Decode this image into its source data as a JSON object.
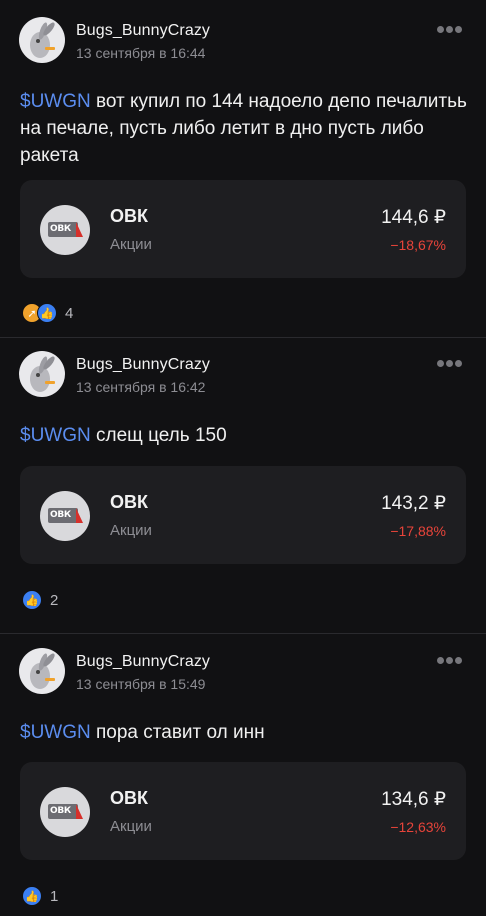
{
  "posts": [
    {
      "author": "Bugs_BunnyCrazy",
      "timestamp": "13 сентября в 16:44",
      "ticker": "$UWGN",
      "text": " вот купил по 144 надоело депо печалитьь на печале, пусть либо летит в дно пусть либо ракета",
      "card": {
        "name": "ОВК",
        "subtitle": "Акции",
        "price": "144,6 ₽",
        "change": "−18,67%",
        "logo_text": "ОВК"
      },
      "reactions": {
        "icons": [
          "rocket-icon",
          "thumbs-up-icon"
        ],
        "count": "4"
      }
    },
    {
      "author": "Bugs_BunnyCrazy",
      "timestamp": "13 сентября в 16:42",
      "ticker": "$UWGN",
      "text": " слещ цель 150",
      "card": {
        "name": "ОВК",
        "subtitle": "Акции",
        "price": "143,2 ₽",
        "change": "−17,88%",
        "logo_text": "ОВК"
      },
      "reactions": {
        "icons": [
          "thumbs-up-icon"
        ],
        "count": "2"
      }
    },
    {
      "author": "Bugs_BunnyCrazy",
      "timestamp": "13 сентября в 15:49",
      "ticker": "$UWGN",
      "text": " пора ставит ол инн",
      "card": {
        "name": "ОВК",
        "subtitle": "Акции",
        "price": "134,6 ₽",
        "change": "−12,63%",
        "logo_text": "ОВК"
      },
      "reactions": {
        "icons": [
          "thumbs-up-icon"
        ],
        "count": "1"
      }
    }
  ],
  "colors": {
    "background": "#111113",
    "card": "#1e1e21",
    "ticker": "#5b8def",
    "negative": "#e8443a",
    "like": "#3b7ff2",
    "rocket": "#f0a22c"
  }
}
